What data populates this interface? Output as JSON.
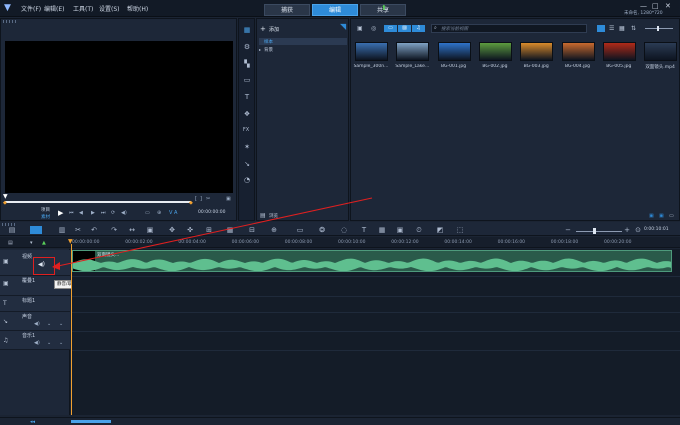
{
  "menu": [
    "文件(F)",
    "编辑(E)",
    "工具(T)",
    "设置(S)",
    "帮助(H)"
  ],
  "modes": [
    {
      "label": "捕获",
      "active": false
    },
    {
      "label": "编辑",
      "active": true
    },
    {
      "label": "共享",
      "active": false
    }
  ],
  "project_info": "未命名, 1280*720",
  "preview": {
    "project_label": "项目",
    "clip_label": "素材",
    "timecode": "00:00:00:00"
  },
  "library": {
    "add_label": "添加",
    "folders": [
      "样本",
      "背景"
    ],
    "browse_label": "浏览",
    "search_placeholder": "搜索当前视图",
    "items": [
      {
        "label": "Sample_300n...",
        "color": "#3a6fb0"
      },
      {
        "label": "Sample_Lake...",
        "color": "#7fa2c4"
      },
      {
        "label": "BG-001.jpg",
        "color": "#2f73c9"
      },
      {
        "label": "BG-002.jpg",
        "color": "#5c9c3f"
      },
      {
        "label": "BG-003.jpg",
        "color": "#d98a2b"
      },
      {
        "label": "BG-004.jpg",
        "color": "#c86a2e"
      },
      {
        "label": "BG-005.jpg",
        "color": "#b12a18"
      },
      {
        "label": "双面镜头.mp4",
        "color": "#2b3b54"
      }
    ]
  },
  "timeline": {
    "ruler": [
      "00:00:00:00",
      "00:00:02:00",
      "00:00:04:00",
      "00:00:06:00",
      "00:00:08:00",
      "00:00:10:00",
      "00:00:12:00",
      "00:00:14:00",
      "00:00:16:00",
      "00:00:18:00",
      "00:00:20:00"
    ],
    "timecode": "0:00:10:01",
    "tracks": [
      {
        "name": "视频"
      },
      {
        "name": "覆叠1"
      },
      {
        "name": "标题1"
      },
      {
        "name": "声音"
      },
      {
        "name": "音乐1"
      }
    ],
    "clip_label": "双面镜头...",
    "tooltip": "静音/取消静音",
    "accent": "#2e8bd8",
    "audio_color": "#5fbf8f",
    "highlight": "#e02020"
  }
}
